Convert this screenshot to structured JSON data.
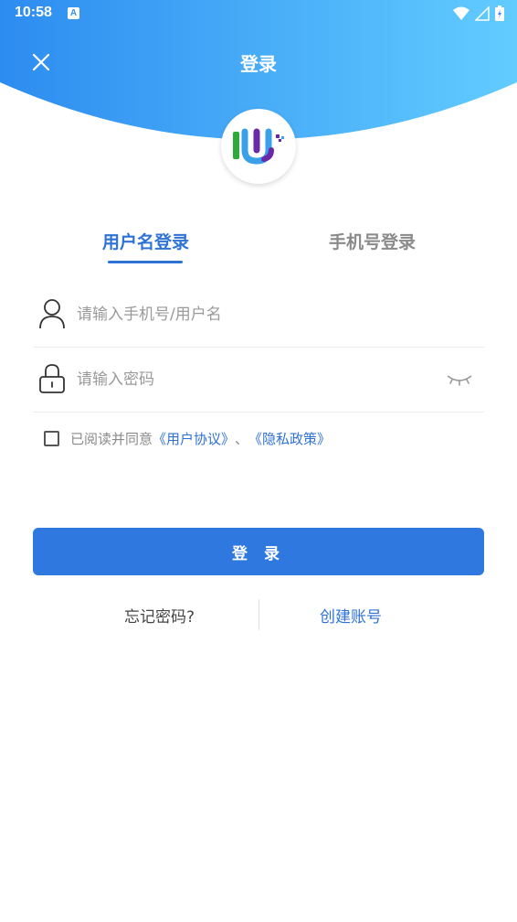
{
  "status_bar": {
    "time": "10:58",
    "notification_icon": "A"
  },
  "header": {
    "title": "登录"
  },
  "tabs": [
    {
      "label": "用户名登录",
      "active": true
    },
    {
      "label": "手机号登录",
      "active": false
    }
  ],
  "form": {
    "username_placeholder": "请输入手机号/用户名",
    "password_placeholder": "请输入密码"
  },
  "agreement": {
    "prefix": "已阅读并同意",
    "user_agreement": "《用户协议》",
    "separator": "、",
    "privacy_policy": "《隐私政策》"
  },
  "login_button": "登 录",
  "links": {
    "forgot_password": "忘记密码?",
    "create_account": "创建账号"
  },
  "colors": {
    "accent": "#2f72d6",
    "header_start": "#2d8cf0",
    "header_end": "#5fcbff"
  }
}
